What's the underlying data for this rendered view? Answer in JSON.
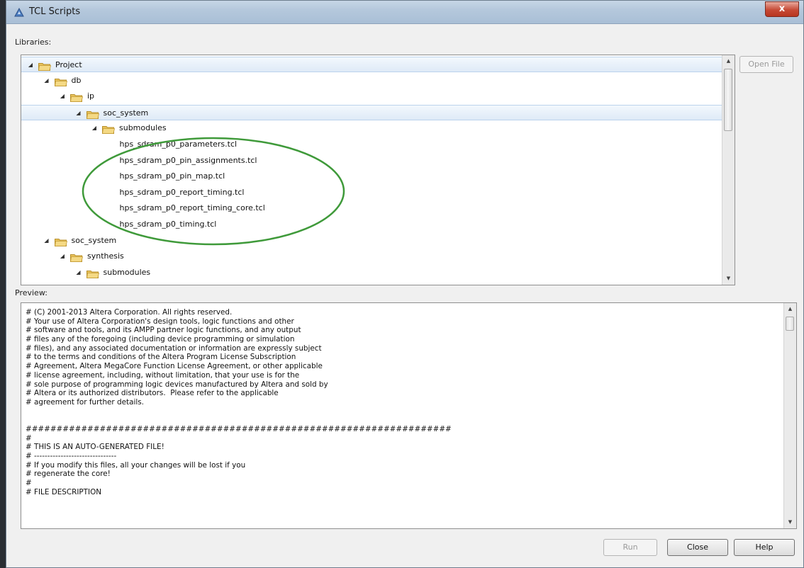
{
  "window": {
    "title": "TCL Scripts",
    "close_glyph": "x",
    "app_icon": "tcl-app-icon"
  },
  "libraries": {
    "label": "Libraries:",
    "tree": [
      {
        "label": "Project",
        "depth": 0,
        "type": "folder",
        "expanded": true,
        "selected": true
      },
      {
        "label": "db",
        "depth": 1,
        "type": "folder",
        "expanded": true
      },
      {
        "label": "ip",
        "depth": 2,
        "type": "folder",
        "expanded": true
      },
      {
        "label": "soc_system",
        "depth": 3,
        "type": "folder",
        "expanded": true,
        "selected": true
      },
      {
        "label": "submodules",
        "depth": 4,
        "type": "folder",
        "expanded": true
      },
      {
        "label": "hps_sdram_p0_parameters.tcl",
        "depth": 5,
        "type": "file"
      },
      {
        "label": "hps_sdram_p0_pin_assignments.tcl",
        "depth": 5,
        "type": "file"
      },
      {
        "label": "hps_sdram_p0_pin_map.tcl",
        "depth": 5,
        "type": "file"
      },
      {
        "label": "hps_sdram_p0_report_timing.tcl",
        "depth": 5,
        "type": "file"
      },
      {
        "label": "hps_sdram_p0_report_timing_core.tcl",
        "depth": 5,
        "type": "file"
      },
      {
        "label": "hps_sdram_p0_timing.tcl",
        "depth": 5,
        "type": "file"
      },
      {
        "label": "soc_system",
        "depth": 1,
        "type": "folder",
        "expanded": true
      },
      {
        "label": "synthesis",
        "depth": 2,
        "type": "folder",
        "expanded": true
      },
      {
        "label": "submodules",
        "depth": 3,
        "type": "folder",
        "expanded": true
      }
    ]
  },
  "open_file_label": "Open File",
  "preview": {
    "label": "Preview:",
    "lines": [
      "# (C) 2001-2013 Altera Corporation. All rights reserved.",
      "# Your use of Altera Corporation's design tools, logic functions and other",
      "# software and tools, and its AMPP partner logic functions, and any output",
      "# files any of the foregoing (including device programming or simulation",
      "# files), and any associated documentation or information are expressly subject",
      "# to the terms and conditions of the Altera Program License Subscription",
      "# Agreement, Altera MegaCore Function License Agreement, or other applicable",
      "# license agreement, including, without limitation, that your use is for the",
      "# sole purpose of programming logic devices manufactured by Altera and sold by",
      "# Altera or its authorized distributors.  Please refer to the applicable",
      "# agreement for further details.",
      "",
      "",
      "#####################################################################",
      "#",
      "# THIS IS AN AUTO-GENERATED FILE!",
      "# -------------------------------",
      "# If you modify this files, all your changes will be lost if you",
      "# regenerate the core!",
      "#",
      "# FILE DESCRIPTION"
    ]
  },
  "buttons": {
    "run": "Run",
    "close": "Close",
    "help": "Help"
  },
  "annotation_color": "#3f9a3a"
}
